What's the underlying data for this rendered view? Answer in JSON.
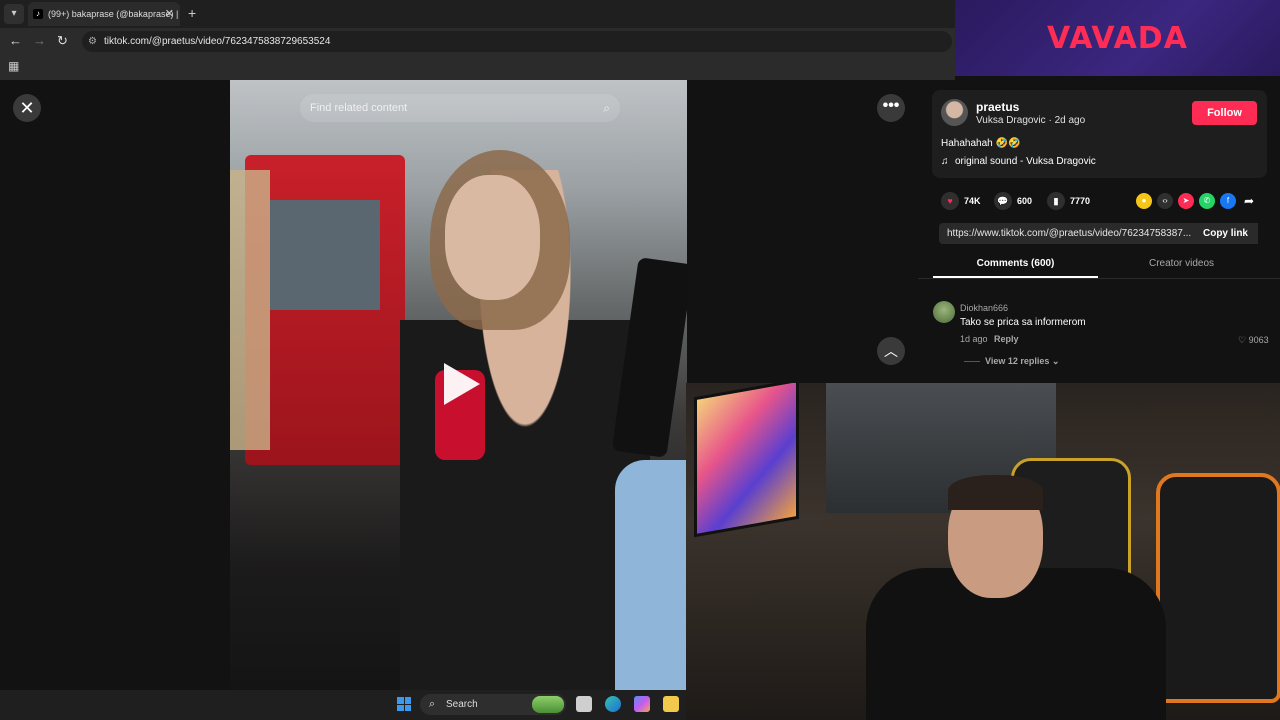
{
  "browser": {
    "tab_title": "(99+) bakaprase (@bakaprase) |",
    "tab_favicon": "tiktok-icon",
    "url": "tiktok.com/@praetus/video/7623475838729653524",
    "accent": "#1f1f1f"
  },
  "ad": {
    "brand": "VAVADA",
    "color": "#ff2d55",
    "bg": "#3b2780"
  },
  "video": {
    "search_placeholder": "Find related content",
    "buttons": {
      "close": "close-icon",
      "more": "more-icon",
      "prev": "chevron-up-icon",
      "play": "play-icon"
    }
  },
  "post": {
    "username": "praetus",
    "display_name": "Vuksa Dragovic",
    "posted": "2d ago",
    "follow_label": "Follow",
    "description": "Hahahahah 🤣🤣",
    "sound": "original sound - Vuksa Dragovic",
    "likes": "74K",
    "comments": "600",
    "saves": "7770",
    "share_link": "https://www.tiktok.com/@praetus/video/76234758387...",
    "copy_link_label": "Copy link",
    "follow_color": "#fe2c55"
  },
  "tabs": {
    "comments": "Comments (600)",
    "creator_videos": "Creator videos"
  },
  "comment": {
    "user": "Diokhan666",
    "text": "Tako se prica sa informerom",
    "age": "1d ago",
    "reply_label": "Reply",
    "likes": "9063",
    "view_replies": "View 12 replies"
  },
  "taskbar": {
    "search_label": "Search"
  }
}
